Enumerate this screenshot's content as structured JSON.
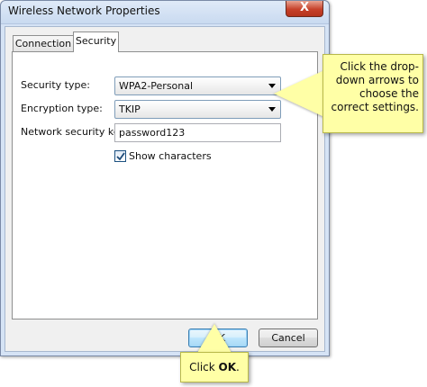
{
  "window": {
    "title": "Wireless Network Properties",
    "close_symbol": "X"
  },
  "tabs": [
    {
      "label": "Connection",
      "selected": false
    },
    {
      "label": "Security",
      "selected": true
    }
  ],
  "form": {
    "security_type": {
      "label": "Security type:",
      "value": "WPA2-Personal"
    },
    "encryption_type": {
      "label": "Encryption type:",
      "value": "TKIP"
    },
    "network_key": {
      "label": "Network security key",
      "value": "password123"
    },
    "show_characters": {
      "label": "Show characters",
      "checked": true
    }
  },
  "buttons": {
    "ok": "OK",
    "cancel": "Cancel"
  },
  "callouts": {
    "dropdown_hint": "Click the drop-down arrows to choose the correct settings.",
    "ok_hint_prefix": "Click ",
    "ok_hint_bold": "OK",
    "ok_hint_suffix": "."
  },
  "colors": {
    "callout_fill": "#ffffa6",
    "window_frame": "#d5e3f5",
    "close_button": "#c6412a"
  }
}
